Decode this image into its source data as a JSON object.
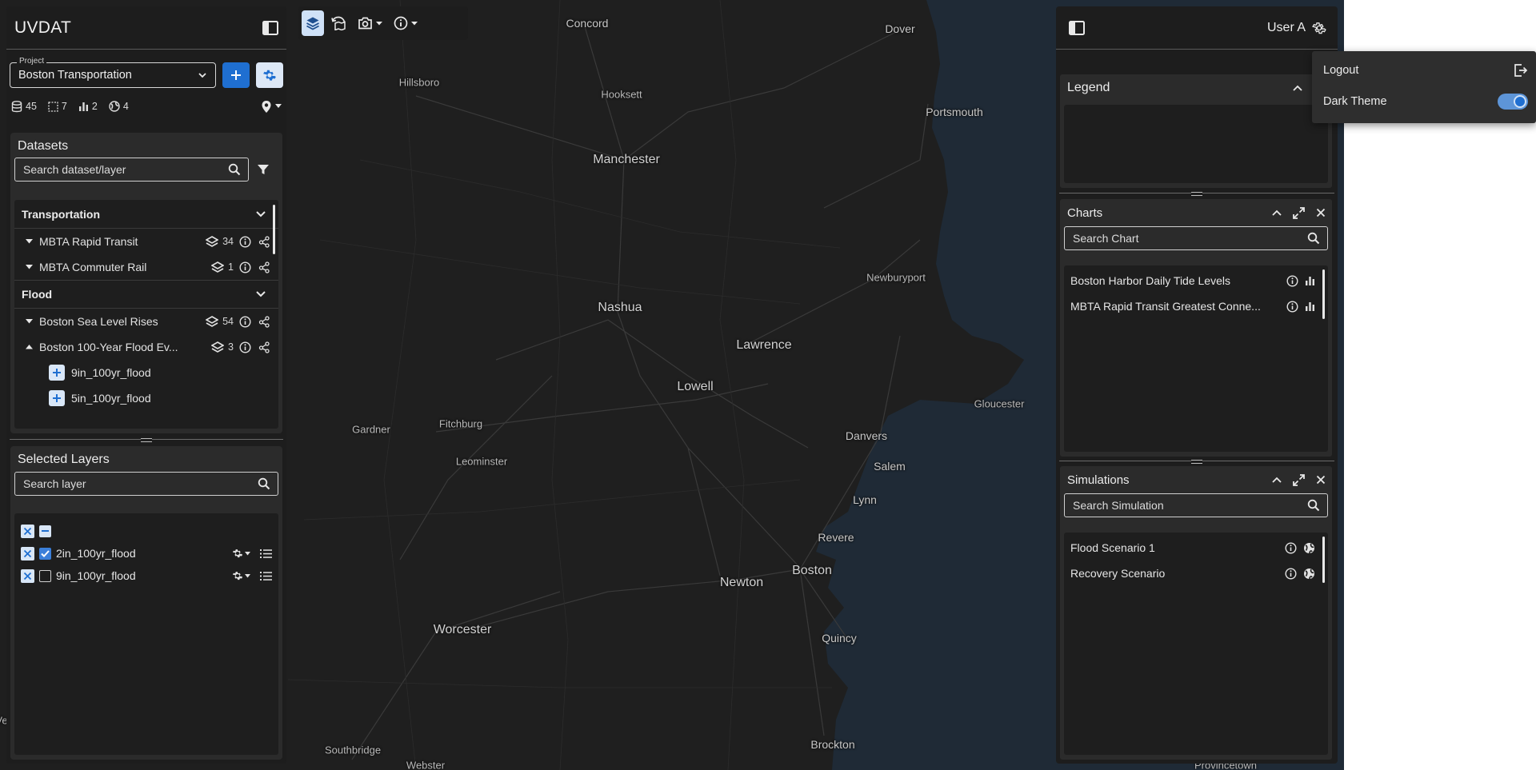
{
  "app": {
    "title": "UVDAT"
  },
  "project": {
    "label": "Project",
    "value": "Boston Transportation"
  },
  "counts": {
    "datasets": "45",
    "regions": "7",
    "charts": "2",
    "networks": "4"
  },
  "datasets": {
    "title": "Datasets",
    "search_placeholder": "Search dataset/layer",
    "groups": [
      {
        "name": "Transportation",
        "items": [
          {
            "name": "MBTA Rapid Transit",
            "layers": "34",
            "expanded": false
          },
          {
            "name": "MBTA Commuter Rail",
            "layers": "1",
            "expanded": false
          }
        ]
      },
      {
        "name": "Flood",
        "items": [
          {
            "name": "Boston Sea Level Rises",
            "layers": "54",
            "expanded": false
          },
          {
            "name": "Boston 100-Year Flood Ev...",
            "layers": "3",
            "expanded": true
          }
        ]
      }
    ],
    "sublayers": [
      "9in_100yr_flood",
      "5in_100yr_flood"
    ]
  },
  "selected_layers": {
    "title": "Selected Layers",
    "search_placeholder": "Search layer",
    "rows": [
      {
        "name": "2in_100yr_flood",
        "checked": true
      },
      {
        "name": "9in_100yr_flood",
        "checked": false
      }
    ]
  },
  "user": {
    "name": "User A"
  },
  "user_menu": {
    "logout": "Logout",
    "dark_theme": "Dark Theme",
    "dark_theme_on": true
  },
  "legend": {
    "title": "Legend"
  },
  "charts": {
    "title": "Charts",
    "search_placeholder": "Search Chart",
    "items": [
      "Boston Harbor Daily Tide Levels",
      "MBTA Rapid Transit Greatest Conne..."
    ]
  },
  "simulations": {
    "title": "Simulations",
    "search_placeholder": "Search Simulation",
    "items": [
      "Flood Scenario 1",
      "Recovery Scenario"
    ]
  },
  "map": {
    "cities": {
      "concord": "Concord",
      "dover": "Dover",
      "hillsboro": "Hillsboro",
      "hooksett": "Hooksett",
      "portsmouth": "Portsmouth",
      "manchester": "Manchester",
      "newburyport": "Newburyport",
      "nashua": "Nashua",
      "lawrence": "Lawrence",
      "lowell": "Lowell",
      "gloucester": "Gloucester",
      "gardner": "Gardner",
      "fitchburg": "Fitchburg",
      "danvers": "Danvers",
      "leominster": "Leominster",
      "salem": "Salem",
      "lynn": "Lynn",
      "revere": "Revere",
      "boston": "Boston",
      "newton": "Newton",
      "worcester": "Worcester",
      "quincy": "Quincy",
      "brockton": "Brockton",
      "southbridge": "Southbridge",
      "webster": "Webster",
      "provincetown": "Provincetown",
      "edge": "Ve"
    }
  },
  "colors": {
    "accent": "#1f6fd1",
    "panel": "#1d1d1d",
    "card": "#2b2b2b",
    "water": "#1f2a36",
    "land": "#1f1f1f"
  }
}
